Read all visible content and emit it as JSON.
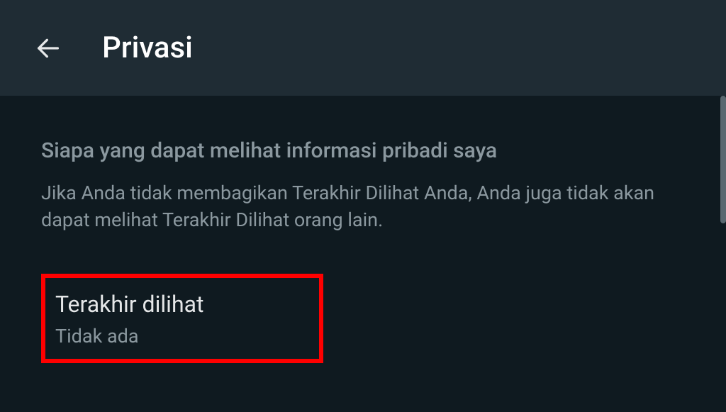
{
  "header": {
    "title": "Privasi"
  },
  "section": {
    "title": "Siapa yang dapat melihat informasi pribadi saya",
    "description": "Jika Anda tidak membagikan Terakhir Dilihat Anda, Anda juga tidak akan dapat melihat Terakhir Dilihat orang lain."
  },
  "setting": {
    "title": "Terakhir dilihat",
    "value": "Tidak ada"
  }
}
